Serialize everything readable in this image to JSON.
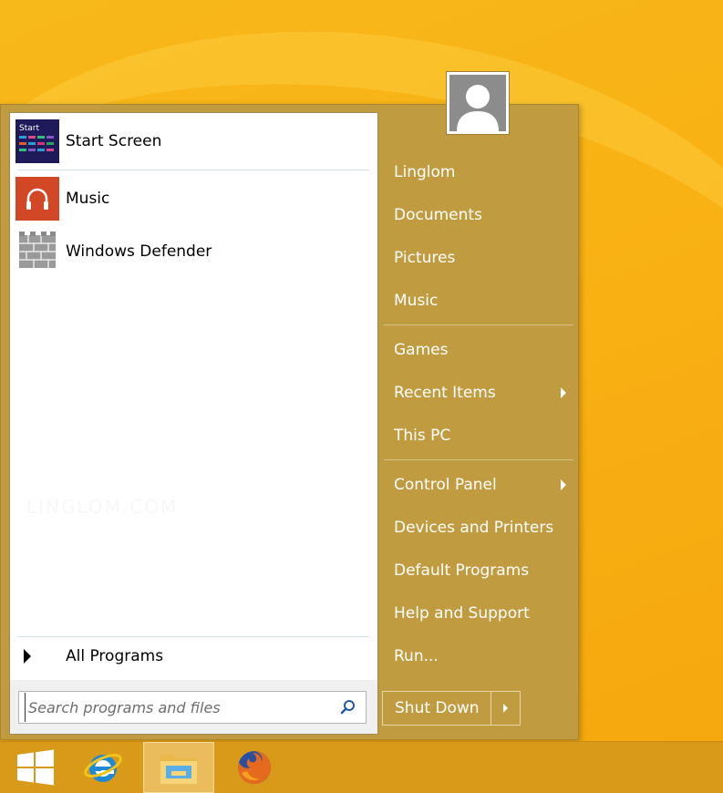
{
  "start_menu": {
    "pinned": [
      {
        "label": "Start Screen",
        "icon": "start-screen-icon",
        "tile_text": "Start"
      },
      {
        "label": "Music",
        "icon": "headphones-icon"
      },
      {
        "label": "Windows Defender",
        "icon": "wall-icon"
      }
    ],
    "all_programs_label": "All Programs",
    "search": {
      "placeholder": "Search programs and files"
    },
    "right_items": [
      {
        "label": "Linglom"
      },
      {
        "label": "Documents"
      },
      {
        "label": "Pictures"
      },
      {
        "label": "Music"
      },
      {
        "label": "Games"
      },
      {
        "label": "Recent Items"
      },
      {
        "label": "This PC"
      },
      {
        "label": "Control Panel"
      },
      {
        "label": "Devices and Printers"
      },
      {
        "label": "Default Programs"
      },
      {
        "label": "Help and Support"
      },
      {
        "label": "Run..."
      }
    ],
    "shutdown_label": "Shut Down",
    "watermark": "LINGLOM.COM"
  },
  "taskbar": {
    "items": [
      {
        "icon": "windows-logo-icon"
      },
      {
        "icon": "internet-explorer-icon"
      },
      {
        "icon": "file-explorer-icon",
        "active": true
      },
      {
        "icon": "firefox-icon"
      }
    ]
  },
  "colors": {
    "menu_bg": "#c19b3f",
    "desktop": "#f9b214",
    "music_tile": "#d24726",
    "start_tile": "#1f1a5a"
  }
}
